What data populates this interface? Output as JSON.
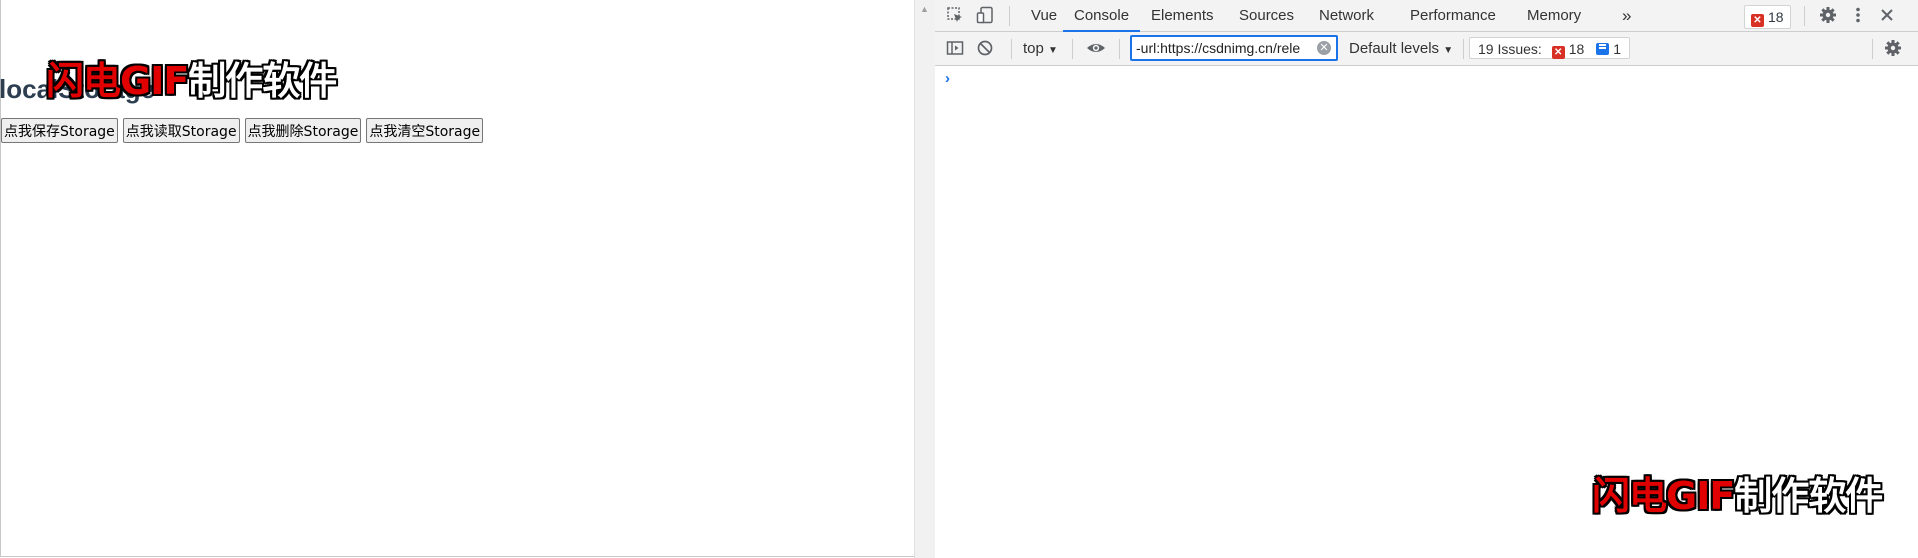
{
  "page": {
    "heading": "localStorage",
    "buttons": [
      "点我保存Storage",
      "点我读取Storage",
      "点我删除Storage",
      "点我清空Storage"
    ],
    "watermark": {
      "red": "闪电GIF",
      "white": "制作软件"
    }
  },
  "devtools": {
    "tabs": [
      "Vue",
      "Console",
      "Elements",
      "Sources",
      "Network",
      "Performance",
      "Memory"
    ],
    "active_tab": "Console",
    "more_tabs_icon": "»",
    "error_count": "18",
    "toolbar": {
      "context": "top",
      "filter_value": "-url:https://csdnimg.cn/rele",
      "levels": "Default levels",
      "issues_label": "19 Issues:",
      "issues_errors": "18",
      "issues_info": "1"
    },
    "prompt": "›"
  },
  "colors": {
    "accent": "#1a73e8",
    "error": "#d93025",
    "heading": "#2c3e50"
  }
}
